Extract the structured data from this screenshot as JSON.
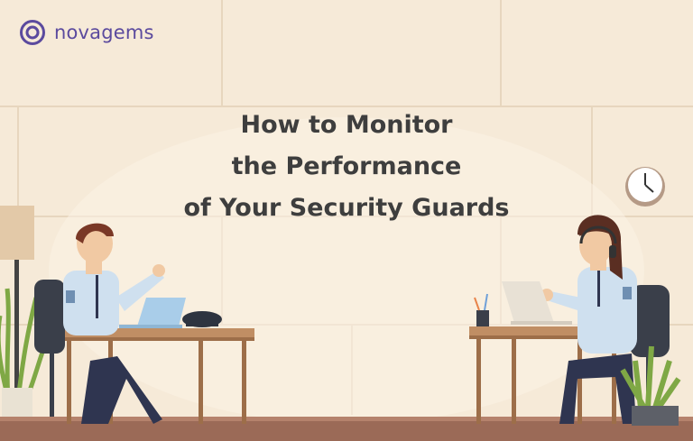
{
  "brand": {
    "name": "novagems",
    "logo_color": "#5b4a9e"
  },
  "headline": {
    "line1": "How to Monitor",
    "line2": "the Performance",
    "line3": "of Your Security Guards"
  },
  "illustration": {
    "icons": [
      "wall-clock-icon",
      "floor-lamp-icon",
      "potted-plant-icon",
      "laptop-icon",
      "desk-phone-icon",
      "headset-icon",
      "pencil-cup-icon"
    ],
    "colors": {
      "wall": "#f6ead8",
      "tile_line": "#ead9c1",
      "floor": "#9b6a57",
      "desk": "#c08e64",
      "uniform": "#cfe0ef",
      "laptop": "#a9cde9",
      "plant": "#7fa845"
    }
  }
}
